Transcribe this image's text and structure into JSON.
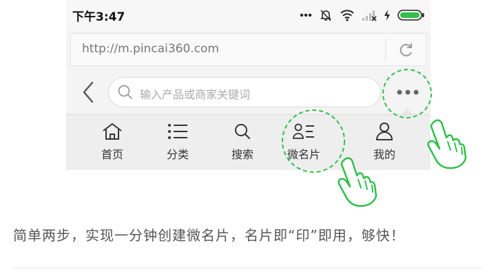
{
  "status": {
    "time": "下午3:47",
    "icons": [
      "more-dots-icon",
      "mute-icon",
      "wifi-icon",
      "signal-icon",
      "charging-icon",
      "battery-icon"
    ]
  },
  "browser": {
    "url": "http://m.pincai360.com",
    "reload_icon": "reload-icon"
  },
  "toolbar": {
    "back_icon": "back-chevron-icon",
    "search_placeholder": "输入产品或商家关键词",
    "more_icon": "more-icon"
  },
  "nav": {
    "items": [
      {
        "label": "首页",
        "icon": "home-icon"
      },
      {
        "label": "分类",
        "icon": "list-icon"
      },
      {
        "label": "搜索",
        "icon": "search-icon"
      },
      {
        "label": "微名片",
        "icon": "card-icon"
      },
      {
        "label": "我的",
        "icon": "user-icon"
      }
    ]
  },
  "caption": "简单两步，实现一分钟创建微名片，名片即“印”即用，够快！",
  "colors": {
    "highlight": "#2fc04a",
    "status_bar": "#f7f7f7",
    "nav_bg": "#eeeeef"
  }
}
